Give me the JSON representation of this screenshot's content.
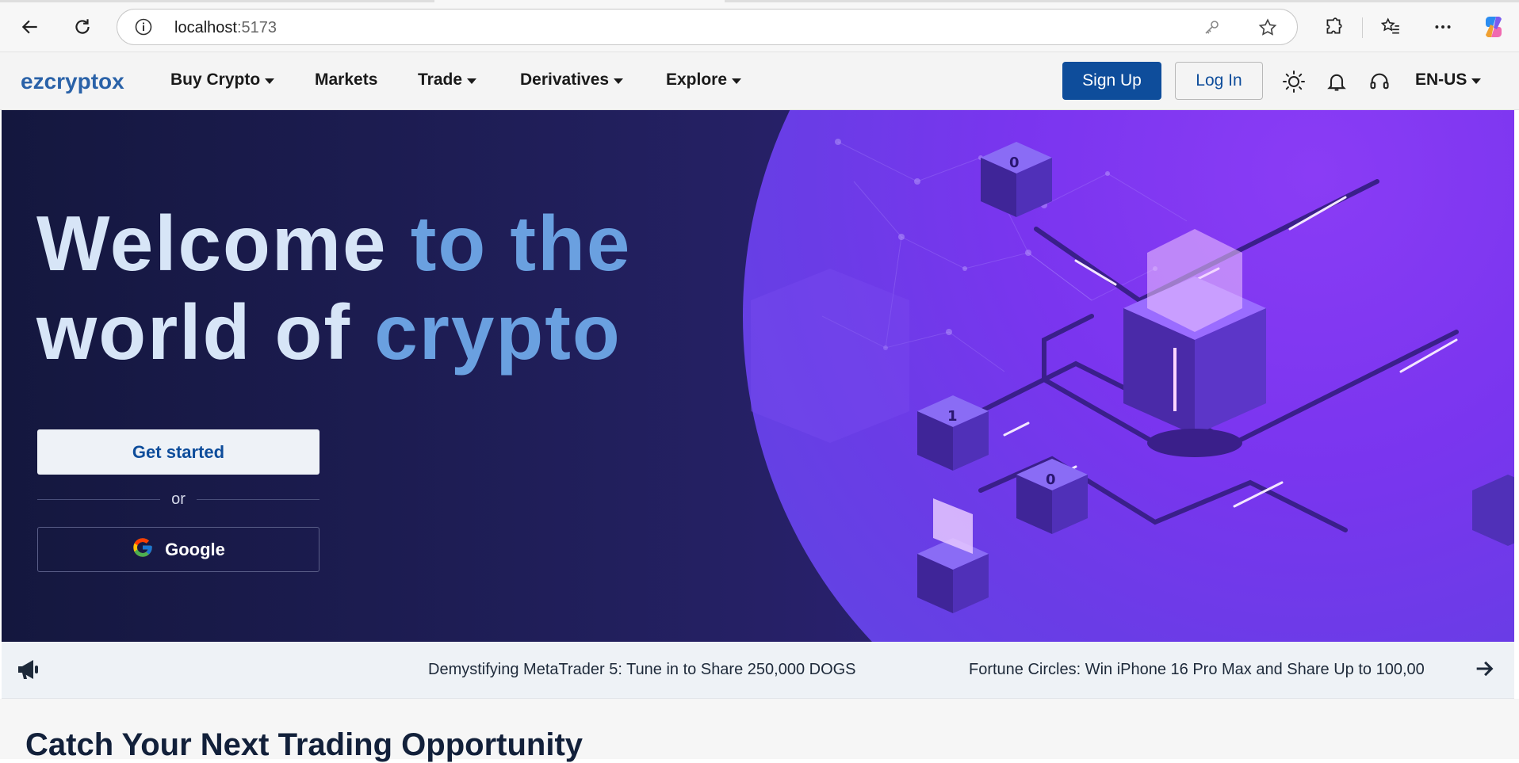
{
  "browser": {
    "url_host": "localhost",
    "url_port": ":5173"
  },
  "nav": {
    "logo": "ezcryptox",
    "items": [
      {
        "label": "Buy Crypto",
        "dropdown": true
      },
      {
        "label": "Markets",
        "dropdown": false
      },
      {
        "label": "Trade",
        "dropdown": true
      },
      {
        "label": "Derivatives",
        "dropdown": true
      },
      {
        "label": "Explore",
        "dropdown": true
      }
    ],
    "signup_label": "Sign Up",
    "login_label": "Log In",
    "language": "EN-US",
    "icons": [
      "theme-sun-icon",
      "notification-bell-icon",
      "support-headset-icon"
    ]
  },
  "hero": {
    "headline_part1_line1": "Welcome ",
    "headline_part2_line1": "to the",
    "headline_part1_line2": "world of ",
    "headline_part2_line2": "crypto",
    "get_started_label": "Get started",
    "or_label": "or",
    "google_label": "Google"
  },
  "ticker": {
    "items": [
      "Demystifying MetaTrader 5: Tune in to Share 250,000 DOGS",
      "Fortune Circles: Win iPhone 16 Pro Max and Share Up to 100,00"
    ]
  },
  "section": {
    "title": "Catch Your Next Trading Opportunity"
  },
  "colors": {
    "brand": "#0e4d9b",
    "logo": "#2a62a8",
    "hero_dark": "#14173e",
    "hero_purple": "#7a35ef"
  }
}
